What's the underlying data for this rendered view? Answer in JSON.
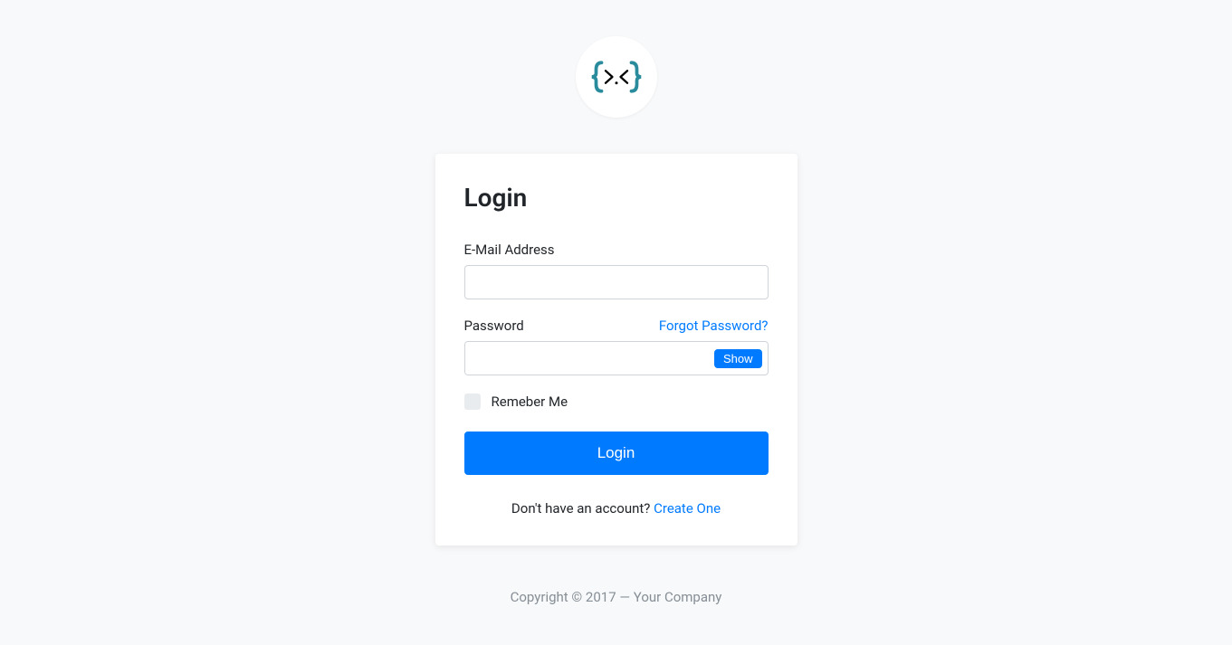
{
  "card": {
    "title": "Login",
    "email_label": "E-Mail Address",
    "password_label": "Password",
    "forgot_link": "Forgot Password?",
    "show_button": "Show",
    "remember_label": "Remeber Me",
    "login_button": "Login",
    "no_account_text": "Don't have an account? ",
    "create_link": "Create One"
  },
  "footer": {
    "copyright": "Copyright © 2017 — Your Company"
  }
}
